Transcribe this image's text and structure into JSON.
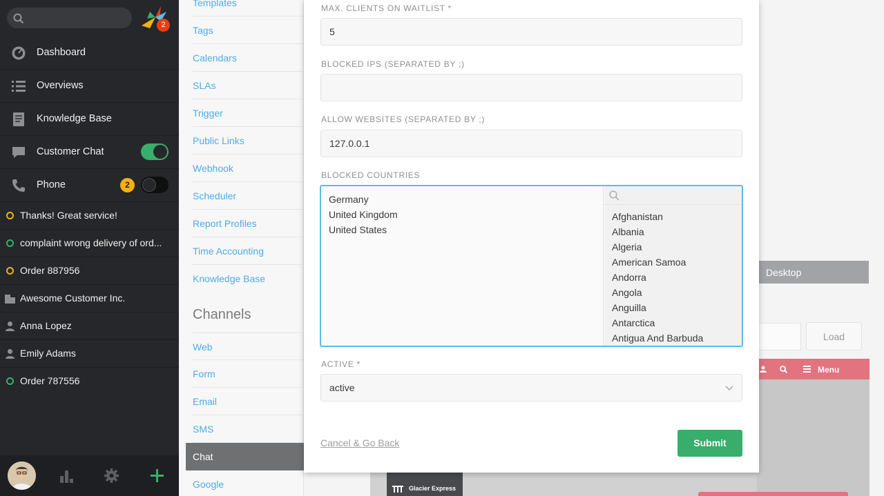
{
  "nav": {
    "search": {
      "placeholder": ""
    },
    "logo_badge": "2",
    "items": [
      {
        "label": "Dashboard",
        "icon": "dashboard-icon"
      },
      {
        "label": "Overviews",
        "icon": "list-icon"
      },
      {
        "label": "Knowledge Base",
        "icon": "book-icon"
      },
      {
        "label": "Customer Chat",
        "icon": "chat-icon",
        "toggle": "on"
      },
      {
        "label": "Phone",
        "icon": "phone-icon",
        "toggle": "off",
        "badge": "2"
      }
    ],
    "tasks": [
      {
        "label": "Thanks! Great service!",
        "icon": "ticket-open-icon",
        "color": "#f6b010"
      },
      {
        "label": "complaint wrong delivery of ord...",
        "icon": "ticket-new-icon",
        "color": "#38ae6a"
      },
      {
        "label": "Order 887956",
        "icon": "ticket-open-icon",
        "color": "#f6b010"
      },
      {
        "label": "Awesome Customer Inc.",
        "icon": "organization-icon"
      },
      {
        "label": "Anna Lopez",
        "icon": "user-icon"
      },
      {
        "label": "Emily Adams",
        "icon": "user-icon"
      },
      {
        "label": "Order 787556",
        "icon": "ticket-new-icon",
        "color": "#38ae6a"
      }
    ],
    "bottom_icons": [
      "avatar",
      "reports-icon",
      "gear-icon",
      "plus-icon"
    ]
  },
  "settings_menu": {
    "items_top": [
      "Templates",
      "Tags",
      "Calendars",
      "SLAs",
      "Trigger",
      "Public Links",
      "Webhook",
      "Scheduler",
      "Report Profiles",
      "Time Accounting",
      "Knowledge Base"
    ],
    "section_heading": "Channels",
    "items_channels": [
      "Web",
      "Form",
      "Email",
      "SMS",
      "Chat",
      "Google"
    ],
    "active": "Chat"
  },
  "background": {
    "desktop_tab": "Desktop",
    "load_button": "Load",
    "preview_menu": "Menu",
    "preview_brand": "Glacier Express"
  },
  "modal": {
    "max_clients": {
      "label": "Max. Clients on Waitlist *",
      "value": "5"
    },
    "blocked_ips": {
      "label": "Blocked IPs (separated by ;)",
      "value": ""
    },
    "allow_websites": {
      "label": "Allow websites (separated by ;)",
      "value": "127.0.0.1"
    },
    "blocked_countries": {
      "label": "Blocked countries",
      "selected": [
        "Germany",
        "United Kingdom",
        "United States"
      ],
      "options": [
        "Afghanistan",
        "Albania",
        "Algeria",
        "American Samoa",
        "Andorra",
        "Angola",
        "Anguilla",
        "Antarctica",
        "Antigua And Barbuda"
      ]
    },
    "active": {
      "label": "Active *",
      "value": "active"
    },
    "cancel_label": "Cancel & Go Back",
    "submit_label": "Submit"
  },
  "colors": {
    "accent_green": "#38ae6a",
    "link_blue": "#4eabe7",
    "focus_blue": "#5bbbe7",
    "warning_orange": "#f6b010",
    "nav_bg": "#26272b"
  }
}
